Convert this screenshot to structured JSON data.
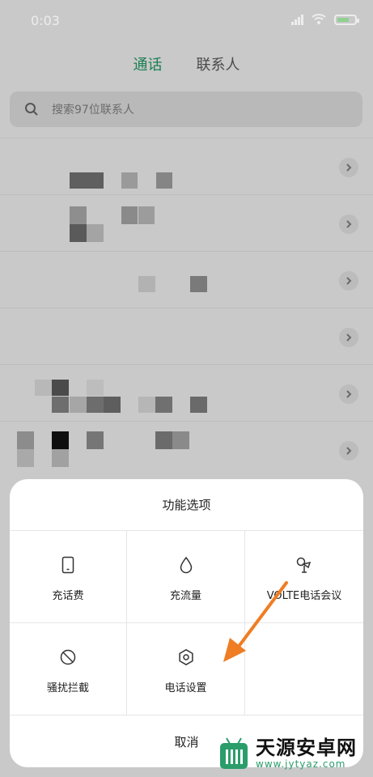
{
  "status_bar": {
    "time": "0:03"
  },
  "tabs": [
    {
      "label": "通话",
      "active": true
    },
    {
      "label": "联系人",
      "active": false
    }
  ],
  "search": {
    "placeholder": "搜索97位联系人"
  },
  "sheet": {
    "title": "功能选项",
    "options": [
      {
        "label": "充话费",
        "icon": "phone-icon"
      },
      {
        "label": "充流量",
        "icon": "droplet-icon"
      },
      {
        "label": "VOLTE电话会议",
        "icon": "conference-icon"
      },
      {
        "label": "骚扰拦截",
        "icon": "block-icon"
      },
      {
        "label": "电话设置",
        "icon": "gear-icon"
      }
    ],
    "cancel": "取消"
  },
  "watermark": {
    "title": "天源安卓网",
    "url": "www.jytyaz.com"
  },
  "colors": {
    "accent": "#1b7f53",
    "arrow": "#ef7d23",
    "overlay": "#c9c9c9"
  }
}
